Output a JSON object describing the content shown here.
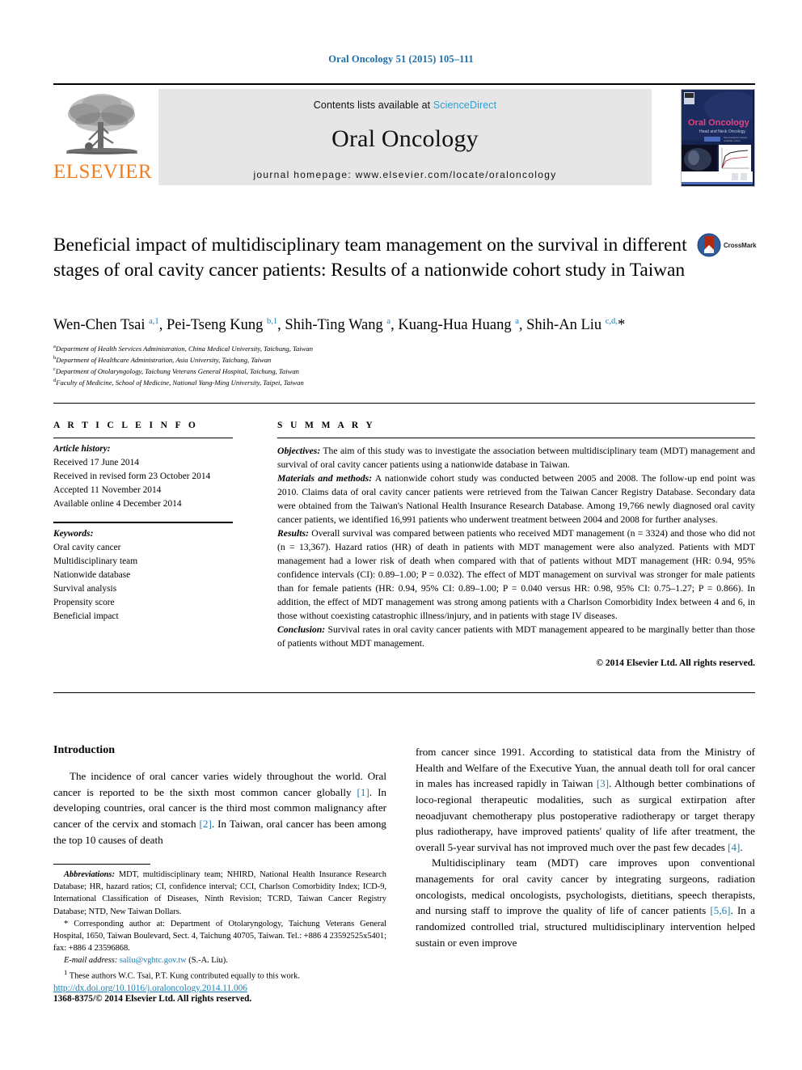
{
  "running_head": "Oral Oncology 51 (2015) 105–111",
  "masthead": {
    "contents_prefix": "Contents lists available at ",
    "sciencedirect": "ScienceDirect",
    "journal_title": "Oral Oncology",
    "homepage": "journal homepage: www.elsevier.com/locate/oraloncology",
    "publisher_logo_text": "ELSEVIER",
    "publisher_logo_icon": "elsevier-tree-icon",
    "cover_icon": "journal-cover-thumbnail",
    "cover_title": "Oral Oncology",
    "cover_subtitle": "Head and Neck Oncology"
  },
  "article": {
    "title": "Beneficial impact of multidisciplinary team management on the survival in different stages of oral cavity cancer patients: Results of a nationwide cohort study in Taiwan",
    "crossmark_label": "CrossMark",
    "crossmark_icon": "crossmark-icon",
    "authors_html": "Wen-Chen Tsai <sup>a,1</sup>, Pei-Tseng Kung <sup>b,1</sup>, Shih-Ting Wang <sup>a</sup>, Kuang-Hua Huang <sup>a</sup>, Shih-An Liu <sup>c,d,</sup>*",
    "affiliations": [
      {
        "marker": "a",
        "text": "Department of Health Services Administration, China Medical University, Taichung, Taiwan"
      },
      {
        "marker": "b",
        "text": "Department of Healthcare Administration, Asia University, Taichung, Taiwan"
      },
      {
        "marker": "c",
        "text": "Department of Otolaryngology, Taichung Veterans General Hospital, Taichung, Taiwan"
      },
      {
        "marker": "d",
        "text": "Faculty of Medicine, School of Medicine, National Yang-Ming University, Taipei, Taiwan"
      }
    ]
  },
  "article_info": {
    "heading": "A R T I C L E    I N F O",
    "history_label": "Article history:",
    "history": [
      "Received 17 June 2014",
      "Received in revised form 23 October 2014",
      "Accepted 11 November 2014",
      "Available online 4 December 2014"
    ],
    "keywords_label": "Keywords:",
    "keywords": [
      "Oral cavity cancer",
      "Multidisciplinary team",
      "Nationwide database",
      "Survival analysis",
      "Propensity score",
      "Beneficial impact"
    ]
  },
  "summary": {
    "heading": "S U M M A R Y",
    "sections": [
      {
        "label": "Objectives:",
        "text": " The aim of this study was to investigate the association between multidisciplinary team (MDT) management and survival of oral cavity cancer patients using a nationwide database in Taiwan."
      },
      {
        "label": "Materials and methods:",
        "text": "  A nationwide cohort study was conducted between 2005 and 2008. The follow-up end point was 2010. Claims data of oral cavity cancer patients were retrieved from the Taiwan Cancer Registry Database. Secondary data were obtained from the Taiwan's National Health Insurance Research Database. Among 19,766 newly diagnosed oral cavity cancer patients, we identified 16,991 patients who underwent treatment between 2004 and 2008 for further analyses."
      },
      {
        "label": "Results:",
        "text": "  Overall survival was compared between patients who received MDT management (n = 3324) and those who did not (n = 13,367). Hazard ratios (HR) of death in patients with MDT management were also analyzed. Patients with MDT management had a lower risk of death when compared with that of patients without MDT management (HR: 0.94, 95% confidence intervals (CI): 0.89–1.00; P = 0.032). The effect of MDT management on survival was stronger for male patients than for female patients (HR: 0.94, 95% CI: 0.89–1.00; P = 0.040 versus HR: 0.98, 95% CI: 0.75–1.27; P = 0.866). In addition, the effect of MDT management was strong among patients with a Charlson Comorbidity Index between 4 and 6, in those without coexisting catastrophic illness/injury, and in patients with stage IV diseases."
      },
      {
        "label": "Conclusion:",
        "text": " Survival rates in oral cavity cancer patients with MDT management appeared to be marginally better than those of patients without MDT management."
      }
    ],
    "copyright": "© 2014 Elsevier Ltd. All rights reserved."
  },
  "body": {
    "left": {
      "heading": "Introduction",
      "paragraph_1_part1": "The incidence of oral cancer varies widely throughout the world. Oral cancer is reported to be the sixth most common cancer globally ",
      "ref1": "[1]",
      "paragraph_1_part2": ". In developing countries, oral cancer is the third most common malignancy after cancer of the cervix and stomach ",
      "ref2": "[2]",
      "paragraph_1_part3": ". In Taiwan, oral cancer has been among the top 10 causes of death"
    },
    "right": {
      "paragraph_1_part1": "from cancer since 1991. According to statistical data from the Ministry of Health and Welfare of the Executive Yuan, the annual death toll for oral cancer in males has increased rapidly in Taiwan ",
      "ref3": "[3]",
      "paragraph_1_part2": ". Although better combinations of loco-regional therapeutic modalities, such as surgical extirpation after neoadjuvant chemotherapy plus postoperative radiotherapy or target therapy plus radiotherapy, have improved patients' quality of life after treatment, the overall 5-year survival has not improved much over the past few decades ",
      "ref4": "[4]",
      "paragraph_1_part3": ".",
      "paragraph_2_part1": "Multidisciplinary team (MDT) care improves upon conventional managements for oral cavity cancer by integrating surgeons, radiation oncologists, medical oncologists, psychologists, dietitians, speech therapists, and nursing staff to improve the quality of life of cancer patients ",
      "ref56": "[5,6]",
      "paragraph_2_part2": ". In a randomized controlled trial, structured multidisciplinary intervention helped sustain or even improve"
    }
  },
  "footnotes": {
    "abbreviations_label": "Abbreviations:",
    "abbreviations_text": " MDT, multidisciplinary team; NHIRD, National Health Insurance Research Database; HR, hazard ratios; CI, confidence interval; CCI, Charlson Comorbidity Index; ICD-9, International Classification of Diseases, Ninth Revision; TCRD, Taiwan Cancer Registry Database; NTD, New Taiwan Dollars.",
    "corresponding_marker": "*",
    "corresponding_text": " Corresponding author at: Department of Otolaryngology, Taichung Veterans General Hospital, 1650, Taiwan Boulevard, Sect. 4, Taichung 40705, Taiwan. Tel.: +886 4 23592525x5401; fax: +886 4 23596868.",
    "email_label": "E-mail address:",
    "email": "saliu@vghtc.gov.tw",
    "email_suffix": " (S.-A. Liu).",
    "equal_contrib_marker": "1",
    "equal_contrib_text": " These authors W.C. Tsai, P.T. Kung contributed equally to this work.",
    "doi": "http://dx.doi.org/10.1016/j.oraloncology.2014.11.006",
    "issn_copyright": "1368-8375/© 2014 Elsevier Ltd. All rights reserved."
  },
  "colors": {
    "link": "#1b7fb5",
    "sciencedirect": "#2a9fd6",
    "running_head": "#1b6ea8",
    "elsevier_orange": "#ef7d22",
    "masthead_gray": "#e6e6e6"
  }
}
